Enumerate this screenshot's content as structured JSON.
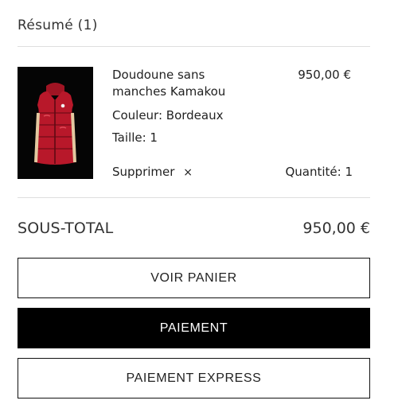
{
  "summary": {
    "title": "Résumé (1)"
  },
  "item": {
    "name": "Doudoune sans manches Kamakou",
    "price": "950,00 €",
    "color": "Couleur: Bordeaux",
    "size": "Taille: 1",
    "remove_label": "Supprimer",
    "remove_icon": "×",
    "quantity": "Quantité: 1",
    "image_icon": "red-puffer-vest-image"
  },
  "totals": {
    "subtotal_label": "SOUS-TOTAL",
    "subtotal_value": "950,00 €"
  },
  "buttons": {
    "view_cart": "VOIR PANIER",
    "checkout": "PAIEMENT",
    "express": "PAIEMENT EXPRESS"
  },
  "colors": {
    "product_bg": "#050505",
    "vest_red": "#b8182a",
    "vest_trim": "#e3c9a0",
    "primary_button": "#000000"
  }
}
